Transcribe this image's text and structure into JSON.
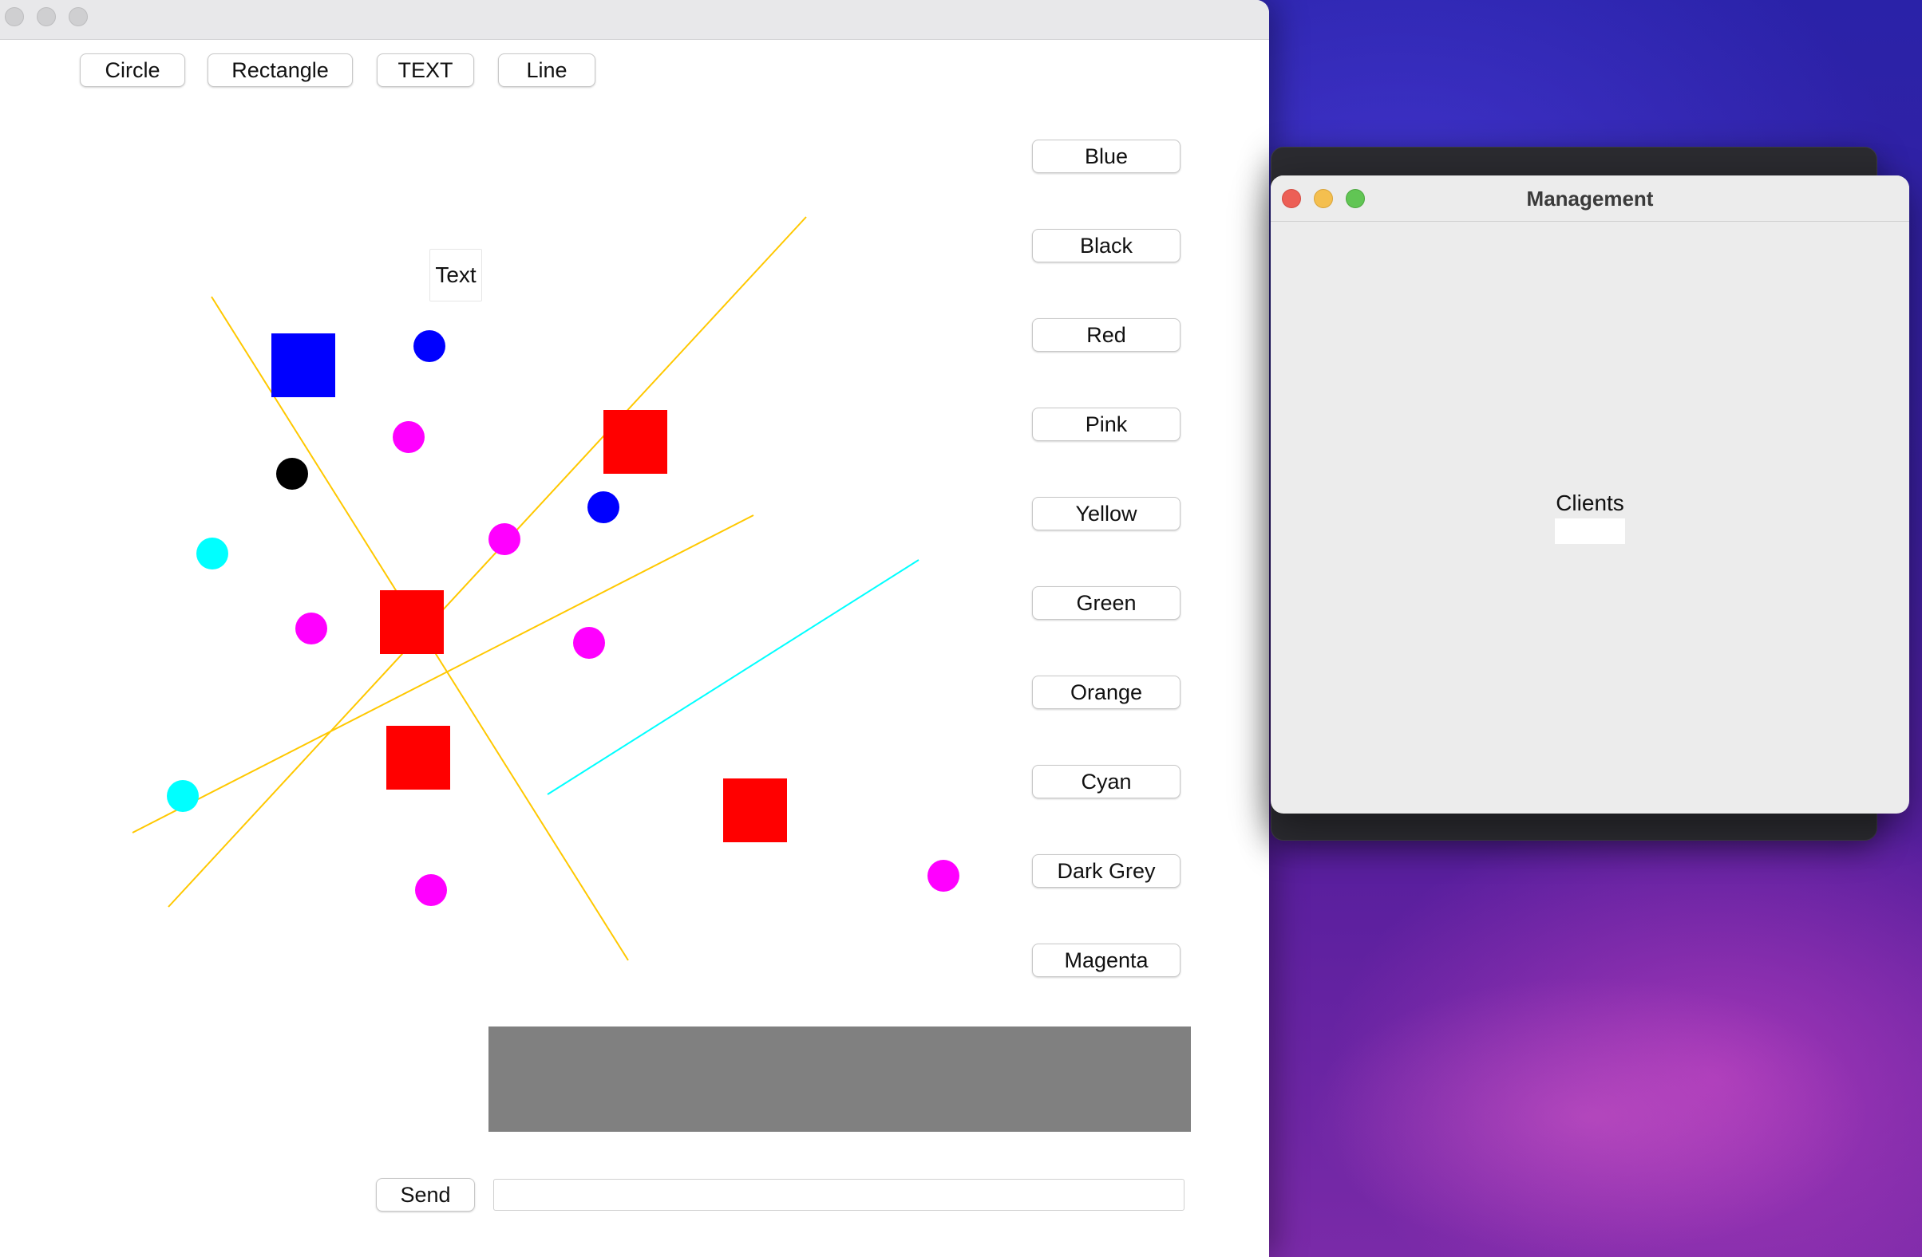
{
  "toolbar": {
    "circle": "Circle",
    "rectangle": "Rectangle",
    "text": "TEXT",
    "line": "Line"
  },
  "colors": {
    "blue": "Blue",
    "black": "Black",
    "red": "Red",
    "pink": "Pink",
    "yellow": "Yellow",
    "green": "Green",
    "orange": "Orange",
    "cyan": "Cyan",
    "dark_grey": "Dark Grey",
    "magenta": "Magenta"
  },
  "canvas": {
    "text_shape_label": "Text",
    "palette": {
      "blue": "#0000ff",
      "red": "#ff0000",
      "magenta": "#ff00ff",
      "black": "#000000",
      "cyan": "#00ffff",
      "yellow": "#ffc800"
    }
  },
  "chat": {
    "send_label": "Send",
    "message_value": ""
  },
  "management": {
    "title": "Management",
    "clients_label": "Clients"
  }
}
